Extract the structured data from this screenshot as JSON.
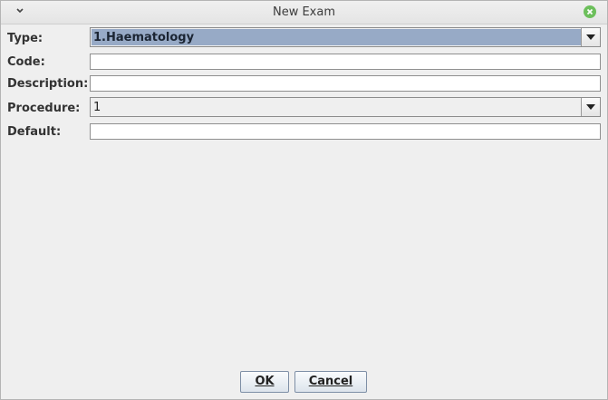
{
  "window": {
    "title": "New Exam"
  },
  "form": {
    "type_label": "Type:",
    "type_value": "1.Haematology",
    "code_label": "Code:",
    "code_value": "",
    "description_label": "Description:",
    "description_value": "",
    "procedure_label": "Procedure:",
    "procedure_value": "1",
    "default_label": "Default:",
    "default_value": ""
  },
  "buttons": {
    "ok": "OK",
    "cancel": "Cancel"
  },
  "icons": {
    "window_menu": "chevron-down-icon",
    "close": "close-icon",
    "dropdown": "triangle-down-icon"
  },
  "colors": {
    "selection": "#97aac6",
    "close_button": "#6cbf5b"
  }
}
